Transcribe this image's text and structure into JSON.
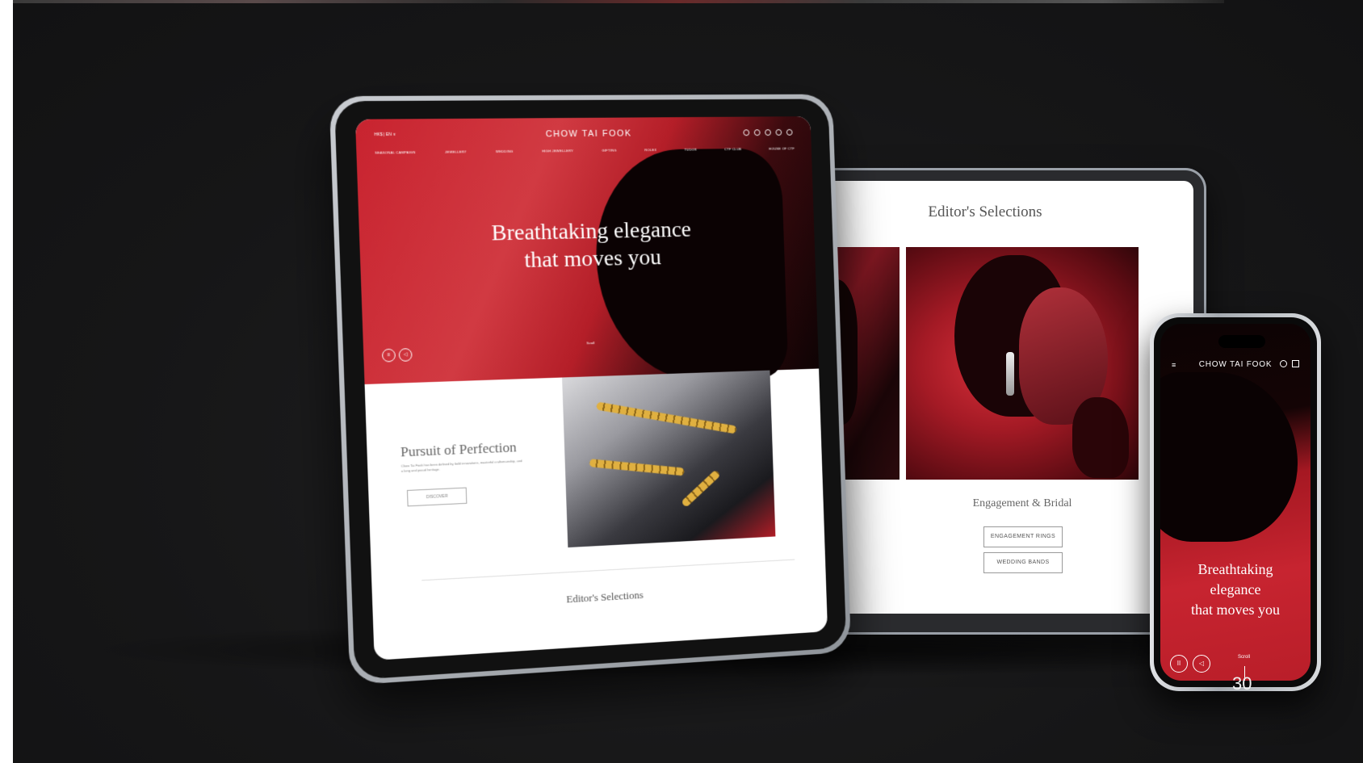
{
  "laptop": {
    "title": "Editor's Selections",
    "section_heading": "Engagement & Bridal",
    "buttons": [
      "ENGAGEMENT RINGS",
      "WEDDING BANDS"
    ]
  },
  "tablet": {
    "top_left": "HK$ | EN ∨",
    "brand": "CHOW TAI FOOK",
    "nav": [
      "SEASONAL CAMPAIGN",
      "JEWELLERY",
      "WEDDING",
      "HIGH JEWELLERY",
      "GIFTING",
      "ROLEX",
      "TUDOR",
      "CTF CLUB",
      "HOUSE OF CTF"
    ],
    "hero_line1": "Breathtaking elegance",
    "hero_line2": "that moves you",
    "scroll_label": "Scroll",
    "pause_icon": "pause-icon",
    "mute_icon": "mute-icon",
    "section_title": "Pursuit of Perfection",
    "section_desc": "Chow Tai Fook has been defined by bold innovations, masterful craftsmanship, and a long and proud heritage.",
    "discover_label": "DISCOVER",
    "footer_title": "Editor's Selections"
  },
  "phone": {
    "brand": "CHOW TAI FOOK",
    "hero_line1": "Breathtaking",
    "hero_line2": "elegance",
    "hero_line3": "that moves you",
    "scroll_label": "Scroll"
  },
  "page_number": "30",
  "colors": {
    "background": "#161617",
    "brand_red": "#c8232f"
  }
}
